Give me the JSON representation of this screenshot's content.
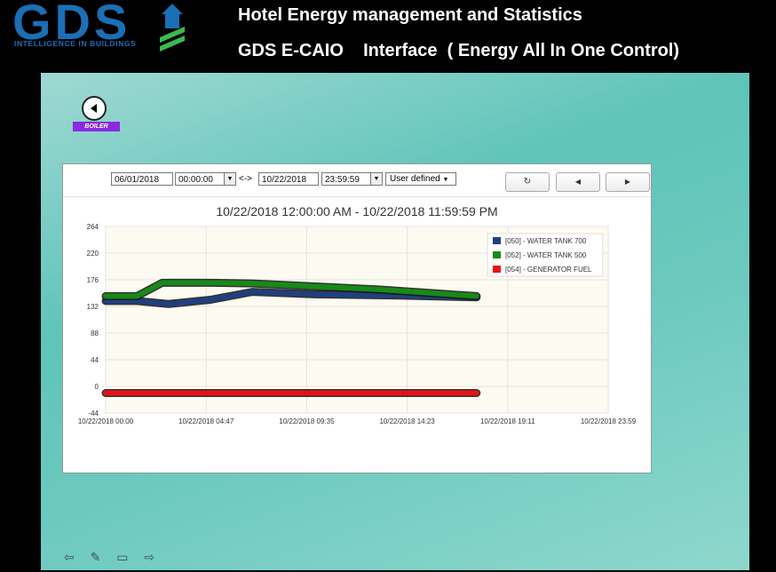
{
  "header": {
    "logo_text": "GDS",
    "logo_tagline": "INTELLIGENCE IN BUILDINGS",
    "title": "Hotel Energy management and Statistics",
    "subtitle": "GDS E-CAIO    Interface  ( Energy All In One Control)"
  },
  "nav": {
    "back_icon": "chevron-left-icon",
    "boiler_label": "BOILER"
  },
  "toolbar": {
    "start_date": "06/01/2018",
    "start_time": "00:00:00",
    "range_sep": "<->",
    "end_date": "10/22/2018",
    "end_time": "23:59:59",
    "range_mode": "User defined",
    "refresh_icon": "refresh-icon",
    "prev_icon": "prev-icon",
    "next_icon": "next-icon"
  },
  "chart_data": {
    "type": "line",
    "title": "10/22/2018 12:00:00 AM - 10/22/2018 11:59:59 PM",
    "xlabel": "",
    "ylabel": "",
    "x_ticks": [
      "10/22/2018 00:00",
      "10/22/2018 04:47",
      "10/22/2018 09:35",
      "10/22/2018 14:23",
      "10/22/2018 19:11",
      "10/22/2018 23:59"
    ],
    "y_ticks": [
      264,
      220,
      176,
      132,
      88,
      44,
      0,
      -44
    ],
    "ylim": [
      -44,
      264
    ],
    "xlim_hours": [
      0,
      23.98
    ],
    "grid": true,
    "legend_position": "top-right",
    "series": [
      {
        "name": "[050] - WATER TANK 700",
        "color": "#1f3f7f",
        "x": [
          0,
          1.5,
          3.0,
          5.0,
          7.0,
          10,
          14,
          17.7
        ],
        "y": [
          141,
          141,
          136,
          143,
          156,
          152,
          150,
          147
        ]
      },
      {
        "name": "[052] - WATER TANK 500",
        "color": "#178a17",
        "x": [
          0,
          1.5,
          2.7,
          5.0,
          7.0,
          10,
          13,
          17.7
        ],
        "y": [
          149,
          149,
          171,
          171,
          170,
          165,
          160,
          149
        ]
      },
      {
        "name": "[054] - GENERATOR FUEL",
        "color": "#e8121a",
        "x": [
          0,
          17.7
        ],
        "y": [
          -11,
          -11
        ]
      }
    ]
  },
  "footer": {
    "icons": [
      "back-arrow-icon",
      "pen-icon",
      "screen-icon",
      "forward-arrow-icon"
    ]
  }
}
